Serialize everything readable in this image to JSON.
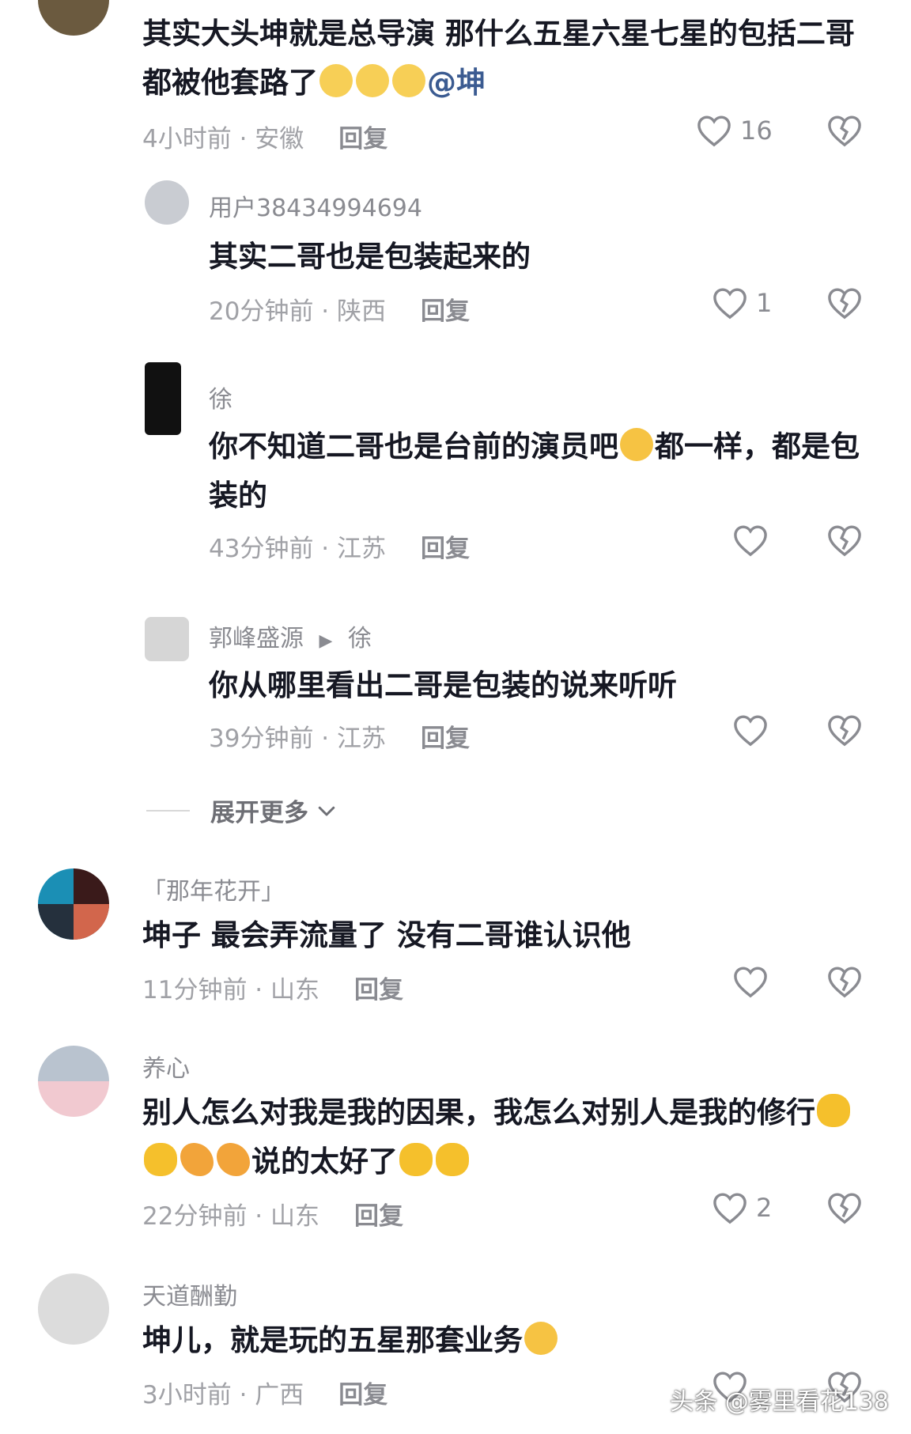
{
  "comments": [
    {
      "text_before": "其实大头坤就是总导演 那什么五星六星七星的包括二哥都被他套路了",
      "mention": "@坤",
      "time": "4小时前",
      "location": "安徽",
      "reply_label": "回复",
      "likes": "16"
    },
    {
      "username": "用户38434994694",
      "text": "其实二哥也是包装起来的",
      "time": "20分钟前",
      "location": "陕西",
      "reply_label": "回复",
      "likes": "1"
    },
    {
      "username": "徐",
      "text_before": "你不知道二哥也是台前的演员吧",
      "text_after": "都一样，都是包装的",
      "time": "43分钟前",
      "location": "江苏",
      "reply_label": "回复"
    },
    {
      "username": "郭峰盛源",
      "reply_to": "徐",
      "text": "你从哪里看出二哥是包装的说来听听",
      "time": "39分钟前",
      "location": "江苏",
      "reply_label": "回复"
    },
    {
      "username": "「那年花开」",
      "text": "坤子 最会弄流量了 没有二哥谁认识他",
      "time": "11分钟前",
      "location": "山东",
      "reply_label": "回复"
    },
    {
      "username": "养心",
      "text_before": "别人怎么对我是我的因果，我怎么对别人是我的修行",
      "text_after": "说的太好了",
      "time": "22分钟前",
      "location": "山东",
      "reply_label": "回复",
      "likes": "2"
    },
    {
      "username": "天道酬勤",
      "text_before": "坤儿，就是玩的五星那套业务",
      "time": "3小时前",
      "location": "广西",
      "reply_label": "回复"
    }
  ],
  "expand_label": "展开更多",
  "watermark": "头条 @雾里看花138",
  "separator": " · ",
  "colors": {
    "text": "#161823",
    "meta": "#a0a1a6",
    "mention": "#3b5b91"
  }
}
